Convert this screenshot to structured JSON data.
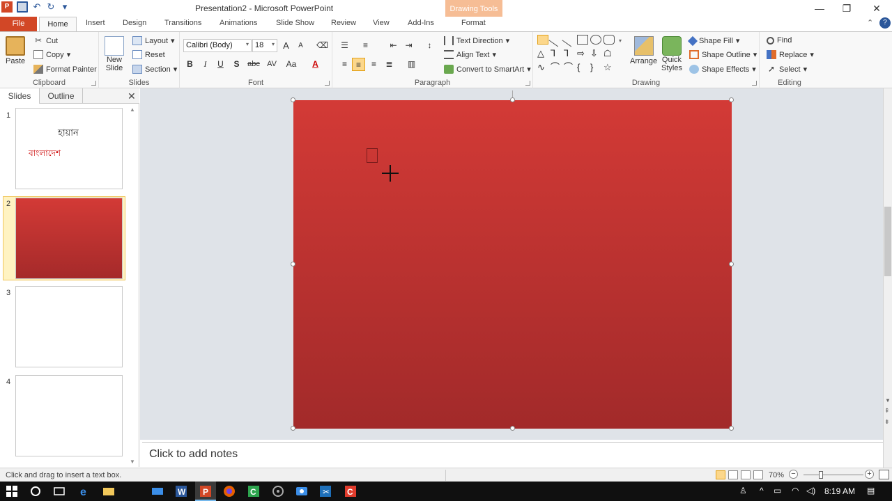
{
  "app": {
    "title": "Presentation2 - Microsoft PowerPoint",
    "contextual_group": "Drawing Tools",
    "app_icon": "P"
  },
  "tabs": {
    "file": "File",
    "home": "Home",
    "insert": "Insert",
    "design": "Design",
    "transitions": "Transitions",
    "animations": "Animations",
    "slideshow": "Slide Show",
    "review": "Review",
    "view": "View",
    "addins": "Add-Ins",
    "format": "Format"
  },
  "ribbon": {
    "clipboard": {
      "label": "Clipboard",
      "paste": "Paste",
      "cut": "Cut",
      "copy": "Copy",
      "format_painter": "Format Painter"
    },
    "slides": {
      "label": "Slides",
      "new_slide_line1": "New",
      "new_slide_line2": "Slide",
      "layout": "Layout",
      "reset": "Reset",
      "section": "Section"
    },
    "font": {
      "label": "Font",
      "font_name": "Calibri (Body)",
      "font_size": "18",
      "bold": "B",
      "italic": "I",
      "underline": "U",
      "shadow": "S",
      "strike": "abc",
      "spacing": "AV",
      "change_case": "Aa",
      "font_color": "A",
      "grow": "A",
      "shrink": "A"
    },
    "paragraph": {
      "label": "Paragraph",
      "text_direction": "Text Direction",
      "align_text": "Align Text",
      "convert_smartart": "Convert to SmartArt"
    },
    "drawing": {
      "label": "Drawing",
      "arrange": "Arrange",
      "quick_styles_line1": "Quick",
      "quick_styles_line2": "Styles",
      "shape_fill": "Shape Fill",
      "shape_outline": "Shape Outline",
      "shape_effects": "Shape Effects"
    },
    "editing": {
      "label": "Editing",
      "find": "Find",
      "replace": "Replace",
      "select": "Select"
    }
  },
  "slides_pane": {
    "tab_slides": "Slides",
    "tab_outline": "Outline",
    "slides": [
      {
        "number": "1",
        "title": "হায়ান",
        "subtitle": "বাংলাদেশ"
      },
      {
        "number": "2"
      },
      {
        "number": "3"
      },
      {
        "number": "4"
      }
    ]
  },
  "notes": {
    "placeholder": "Click to add notes"
  },
  "status": {
    "message": "Click and drag to insert a text box.",
    "zoom": "70%"
  },
  "taskbar": {
    "time": "8:19 AM"
  },
  "colors": {
    "slide_top": "#d33a36",
    "slide_bottom": "#a22a2a",
    "file_tab": "#d24726",
    "contextual": "#f4b183"
  }
}
